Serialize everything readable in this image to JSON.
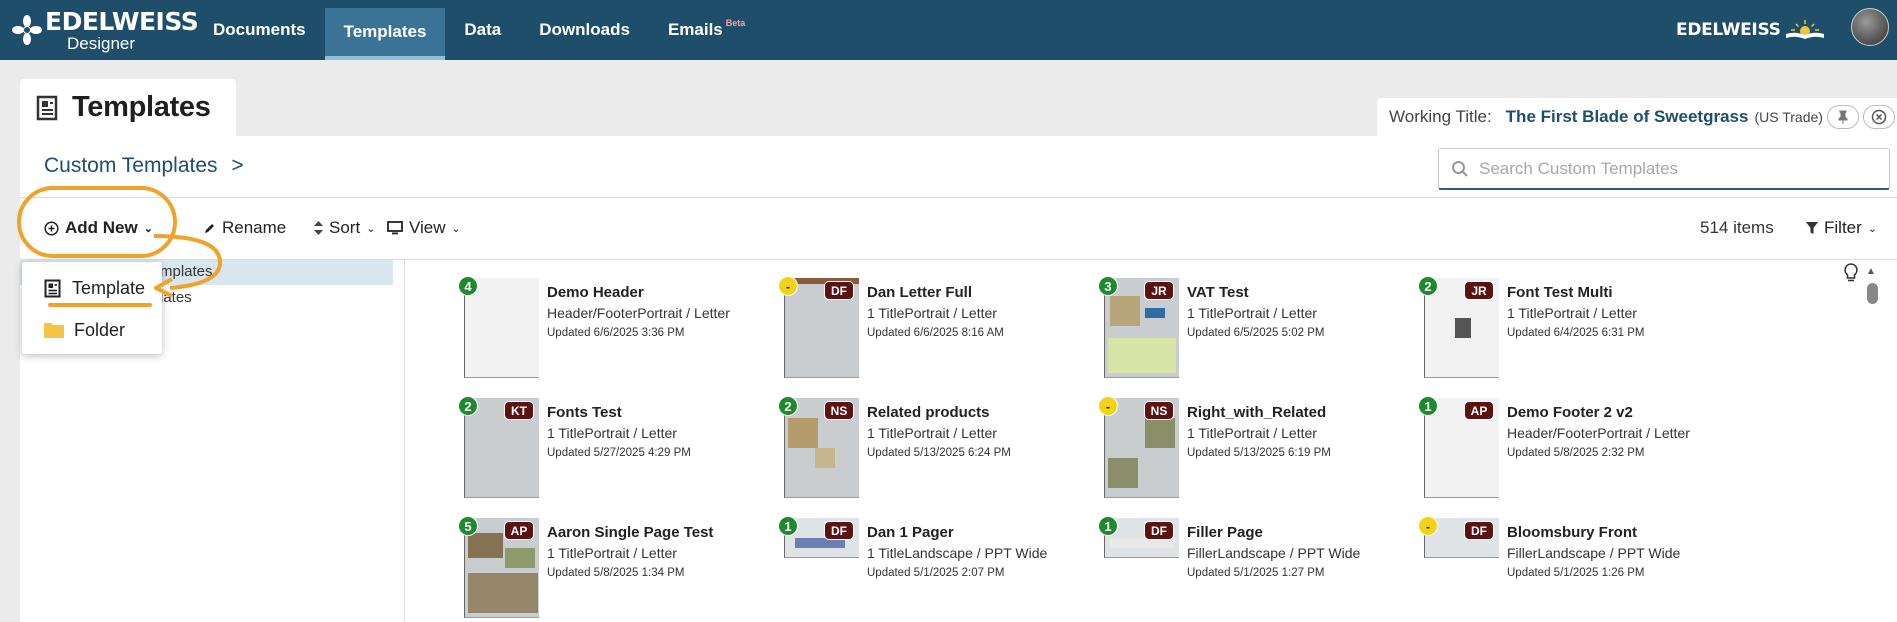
{
  "app": {
    "logo_main": "EDELWEISS",
    "logo_sub": "Designer",
    "brand_right": "EDELWEISS"
  },
  "nav": {
    "items": [
      {
        "label": "Documents"
      },
      {
        "label": "Templates",
        "active": true
      },
      {
        "label": "Data"
      },
      {
        "label": "Downloads"
      },
      {
        "label": "Emails",
        "badge": "Beta"
      }
    ]
  },
  "page": {
    "title": "Templates",
    "breadcrumb": "Custom Templates",
    "breadcrumb_sep": ">"
  },
  "working_title": {
    "label": "Working Title:",
    "title": "The First Blade of Sweetgrass",
    "edition": "(US Trade)"
  },
  "search": {
    "placeholder": "Search Custom Templates"
  },
  "toolbar": {
    "add_new": "Add New",
    "rename": "Rename",
    "sort": "Sort",
    "view": "View",
    "items_count": "514 items",
    "filter": "Filter"
  },
  "dropdown": {
    "items": [
      {
        "label": "Template",
        "icon": "template-icon"
      },
      {
        "label": "Folder",
        "icon": "folder-icon"
      }
    ]
  },
  "tree": {
    "item1_partial": "mplates",
    "item2_partial": "lates"
  },
  "templates": [
    {
      "count": "4",
      "count_color": "green",
      "initials": "",
      "name": "Demo Header",
      "type": "Header/FooterPortrait / Letter",
      "updated": "Updated 6/6/2025 3:36 PM"
    },
    {
      "count": "-",
      "count_color": "yellow",
      "initials": "DF",
      "name": "Dan Letter Full",
      "type": "1 TitlePortrait / Letter",
      "updated": "Updated 6/6/2025 8:16 AM"
    },
    {
      "count": "3",
      "count_color": "green",
      "initials": "JR",
      "name": "VAT Test",
      "type": "1 TitlePortrait / Letter",
      "updated": "Updated 6/5/2025 5:02 PM"
    },
    {
      "count": "2",
      "count_color": "green",
      "initials": "JR",
      "name": "Font Test Multi",
      "type": "1 TitlePortrait / Letter",
      "updated": "Updated 6/4/2025 6:31 PM"
    },
    {
      "count": "2",
      "count_color": "green",
      "initials": "KT",
      "name": "Fonts Test",
      "type": "1 TitlePortrait / Letter",
      "updated": "Updated 5/27/2025 4:29 PM"
    },
    {
      "count": "2",
      "count_color": "green",
      "initials": "NS",
      "name": "Related products",
      "type": "1 TitlePortrait / Letter",
      "updated": "Updated 5/13/2025 6:24 PM"
    },
    {
      "count": "-",
      "count_color": "yellow",
      "initials": "NS",
      "name": "Right_with_Related",
      "type": "1 TitlePortrait / Letter",
      "updated": "Updated 5/13/2025 6:19 PM"
    },
    {
      "count": "1",
      "count_color": "green",
      "initials": "AP",
      "name": "Demo Footer 2 v2",
      "type": "Header/FooterPortrait / Letter",
      "updated": "Updated 5/8/2025 2:32 PM"
    },
    {
      "count": "5",
      "count_color": "green",
      "initials": "AP",
      "name": "Aaron Single Page Test",
      "type": "1 TitlePortrait / Letter",
      "updated": "Updated 5/8/2025 1:34 PM"
    },
    {
      "count": "1",
      "count_color": "green",
      "initials": "DF",
      "name": "Dan 1 Pager",
      "type": "1 TitleLandscape / PPT Wide",
      "updated": "Updated 5/1/2025 2:07 PM"
    },
    {
      "count": "1",
      "count_color": "green",
      "initials": "DF",
      "name": "Filler Page",
      "type": "FillerLandscape / PPT Wide",
      "updated": "Updated 5/1/2025 1:27 PM"
    },
    {
      "count": "-",
      "count_color": "yellow",
      "initials": "DF",
      "name": "Bloomsbury Front",
      "type": "FillerLandscape / PPT Wide",
      "updated": "Updated 5/1/2025 1:26 PM"
    }
  ],
  "colors": {
    "topbar": "#1f4e6b",
    "nav_active": "#3b7397",
    "highlight": "#f0a32b",
    "badge_green": "#1e8a2e",
    "badge_yellow": "#f3d21a",
    "initials_bg": "#5a1212"
  }
}
